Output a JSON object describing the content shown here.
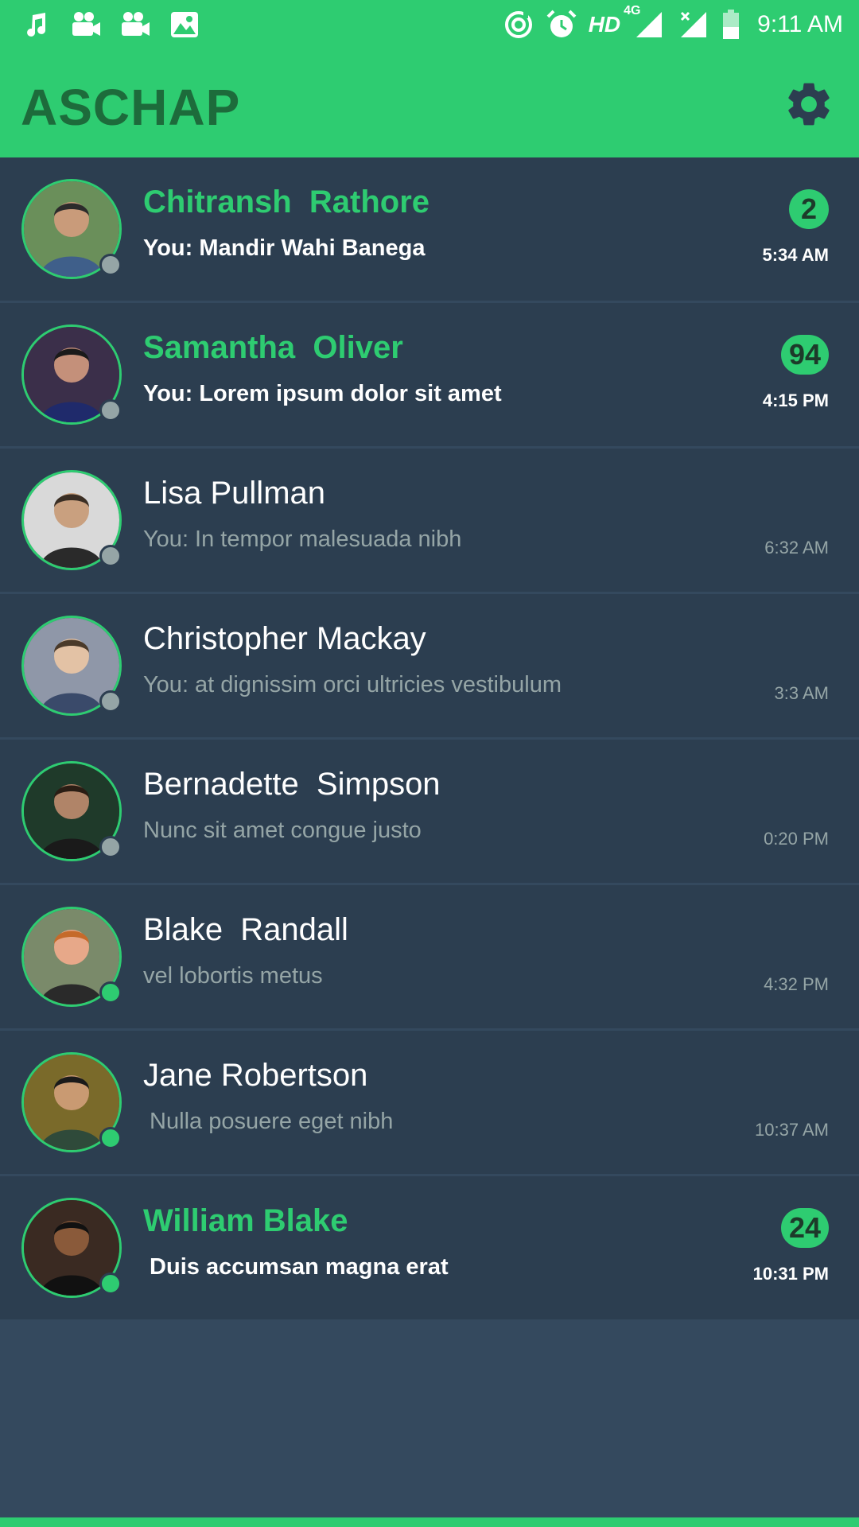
{
  "status_bar": {
    "left_icons": [
      "music-note-icon",
      "video-camera-icon",
      "video-camera-icon",
      "image-icon"
    ],
    "right_icons": [
      "data-saver-icon",
      "alarm-icon"
    ],
    "hd_label": "HD",
    "network_label": "4G",
    "time": "9:11 AM"
  },
  "app_bar": {
    "title": "ASCHAP",
    "settings_icon": "gear-icon"
  },
  "colors": {
    "accent": "#2ecc71",
    "accent_dark_text": "#1d6b3b",
    "row_background": "#2c3e50",
    "page_background": "#34495e",
    "muted_text": "#95a5a6",
    "status_offline": "#95a5a6",
    "status_online": "#2ecc71"
  },
  "chats": [
    {
      "name": "Chitransh  Rathore",
      "message": "You: Mandir Wahi Banega",
      "time": "5:34 AM",
      "unread_count": "2",
      "unread": true,
      "online": false
    },
    {
      "name": "Samantha  Oliver",
      "message": "You: Lorem ipsum dolor sit amet",
      "time": "4:15 PM",
      "unread_count": "94",
      "unread": true,
      "online": false
    },
    {
      "name": "Lisa Pullman",
      "message": "You: In tempor malesuada nibh",
      "time": "6:32 AM",
      "unread_count": "",
      "unread": false,
      "online": false
    },
    {
      "name": "Christopher Mackay",
      "message": "You: at dignissim orci ultricies vestibulum",
      "time": "3:3 AM",
      "unread_count": "",
      "unread": false,
      "online": false
    },
    {
      "name": "Bernadette  Simpson",
      "message": "Nunc sit amet congue justo",
      "time": "0:20 PM",
      "unread_count": "",
      "unread": false,
      "online": false
    },
    {
      "name": "Blake  Randall",
      "message": "vel lobortis metus",
      "time": "4:32 PM",
      "unread_count": "",
      "unread": false,
      "online": true
    },
    {
      "name": "Jane Robertson",
      "message": " Nulla posuere eget nibh",
      "time": "10:37 AM",
      "unread_count": "",
      "unread": false,
      "online": true
    },
    {
      "name": "William Blake",
      "message": " Duis accumsan magna erat",
      "time": "10:31 PM",
      "unread_count": "24",
      "unread": true,
      "online": true
    }
  ]
}
